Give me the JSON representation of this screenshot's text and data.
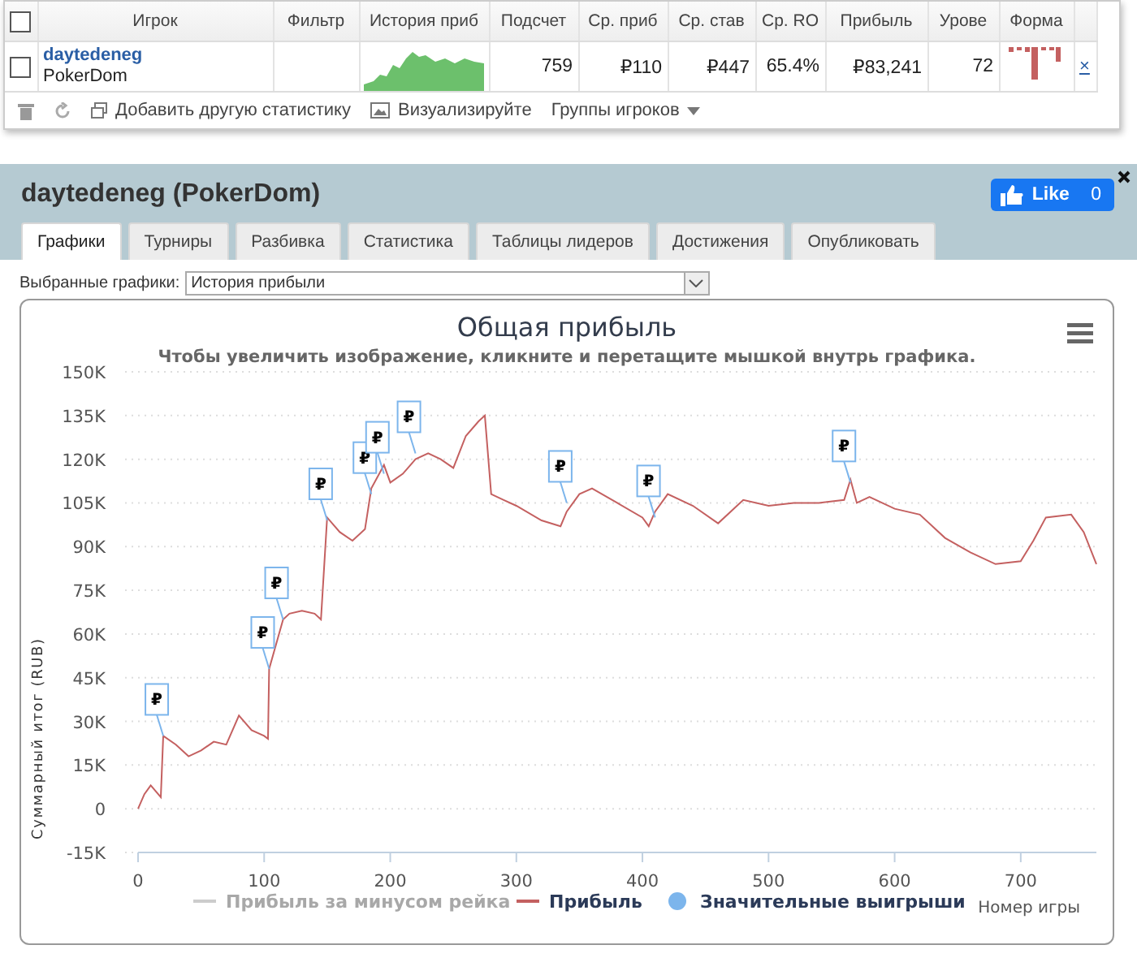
{
  "stats_table": {
    "columns": [
      {
        "kind": "checkbox"
      },
      {
        "label": "Игрок"
      },
      {
        "label": "Фильтр"
      },
      {
        "label": "История приб"
      },
      {
        "label": "Подсчет"
      },
      {
        "label": "Ср. приб"
      },
      {
        "label": "Ср. став"
      },
      {
        "label": "Ср. RO"
      },
      {
        "label": "Прибыль"
      },
      {
        "label": "Урове"
      },
      {
        "label": "Форма"
      },
      {
        "kind": "action"
      }
    ],
    "header_checked": false,
    "rows": [
      {
        "checked": false,
        "player": "daytedeneg",
        "site": "PokerDom",
        "count": "759",
        "avg_profit": "₽110",
        "avg_stake": "₽447",
        "avg_roi": "65.4%",
        "profit": "₽83,241",
        "level": "72",
        "remove": "×"
      }
    ]
  },
  "toolbar": {
    "add_stat": "Добавить другую статистику",
    "visualize": "Визуализируйте",
    "groups": "Группы игроков"
  },
  "panel": {
    "title": "daytedeneg (PokerDom)",
    "like": {
      "label": "Like",
      "count": "0"
    },
    "tabs": [
      {
        "label": "Графики",
        "selected": true
      },
      {
        "label": "Турниры",
        "selected": false
      },
      {
        "label": "Разбивка",
        "selected": false
      },
      {
        "label": "Статистика",
        "selected": false
      },
      {
        "label": "Таблицы лидеров",
        "selected": false
      },
      {
        "label": "Достижения",
        "selected": false
      },
      {
        "label": "Опубликовать",
        "selected": false
      }
    ],
    "chart_select": {
      "label": "Выбранные графики:",
      "value": "История прибыли"
    },
    "chart": {
      "legend": [
        {
          "label": "Прибыль за минусом рейка",
          "kind": "line",
          "hidden": true,
          "color": "#cccccc"
        },
        {
          "kind": "series",
          "hidden": false
        },
        {
          "label": "Значительные выигрыши",
          "kind": "dot",
          "hidden": false,
          "color": "#7cb5ec"
        }
      ],
      "chart_data": {
        "type": "line",
        "grid": true,
        "title": "Общая прибыль",
        "subtitle": "Чтобы увеличить изображение, кликните и перетащите мышкой внутрь графика.",
        "xlabel": "Номер игры",
        "ylabel": "Суммарный итог (RUB)",
        "x": [
          0,
          5,
          10,
          18,
          20,
          30,
          40,
          50,
          60,
          70,
          80,
          90,
          100,
          103,
          104,
          115,
          120,
          130,
          140,
          145,
          150,
          160,
          170,
          180,
          185,
          195,
          200,
          210,
          220,
          230,
          240,
          250,
          260,
          270,
          275,
          280,
          290,
          300,
          320,
          335,
          340,
          350,
          360,
          380,
          400,
          405,
          410,
          420,
          440,
          460,
          480,
          500,
          520,
          540,
          560,
          565,
          570,
          580,
          600,
          620,
          640,
          660,
          680,
          700,
          710,
          720,
          740,
          750,
          760
        ],
        "series": [
          {
            "name": "Прибыль",
            "color": "#c46060",
            "values": [
              0,
              5000,
              8000,
              4000,
              25000,
              22000,
              18000,
              20000,
              23000,
              22000,
              32000,
              27000,
              25000,
              24000,
              48000,
              65000,
              67000,
              68000,
              67000,
              65000,
              100000,
              95000,
              92000,
              96000,
              110000,
              118000,
              112000,
              115000,
              120000,
              122000,
              120000,
              117000,
              128000,
              133000,
              135000,
              108000,
              106000,
              104000,
              99000,
              97000,
              102000,
              108000,
              110000,
              105000,
              100000,
              97000,
              102000,
              108000,
              104000,
              98000,
              106000,
              104000,
              105000,
              105000,
              106000,
              113000,
              105000,
              107000,
              103000,
              101000,
              93000,
              88000,
              84000,
              85000,
              92000,
              100000,
              101000,
              95000,
              84000
            ]
          }
        ],
        "xlim": [
          0,
          760
        ],
        "ylim": [
          -15000,
          150000
        ],
        "xticks": [
          0,
          100,
          200,
          300,
          400,
          500,
          600,
          700
        ],
        "yticks": [
          {
            "value": -15000,
            "label": "-15K"
          },
          {
            "value": 0,
            "label": "0"
          },
          {
            "value": 15000,
            "label": "15K"
          },
          {
            "value": 30000,
            "label": "30K"
          },
          {
            "value": 45000,
            "label": "45K"
          },
          {
            "value": 60000,
            "label": "60K"
          },
          {
            "value": 75000,
            "label": "75K"
          },
          {
            "value": 90000,
            "label": "90K"
          },
          {
            "value": 105000,
            "label": "105K"
          },
          {
            "value": 120000,
            "label": "120K"
          },
          {
            "value": 135000,
            "label": "135K"
          },
          {
            "value": 150000,
            "label": "150K"
          }
        ],
        "annotations": [
          {
            "x": 20,
            "y": 25000,
            "text": "₽"
          },
          {
            "x": 104,
            "y": 48000,
            "text": "₽"
          },
          {
            "x": 115,
            "y": 65000,
            "text": "₽"
          },
          {
            "x": 150,
            "y": 99000,
            "text": "₽"
          },
          {
            "x": 185,
            "y": 108000,
            "text": "₽"
          },
          {
            "x": 195,
            "y": 115000,
            "text": "₽"
          },
          {
            "x": 220,
            "y": 122000,
            "text": "₽"
          },
          {
            "x": 340,
            "y": 105000,
            "text": "₽"
          },
          {
            "x": 410,
            "y": 100000,
            "text": "₽"
          },
          {
            "x": 565,
            "y": 112000,
            "text": "₽"
          }
        ]
      }
    }
  }
}
